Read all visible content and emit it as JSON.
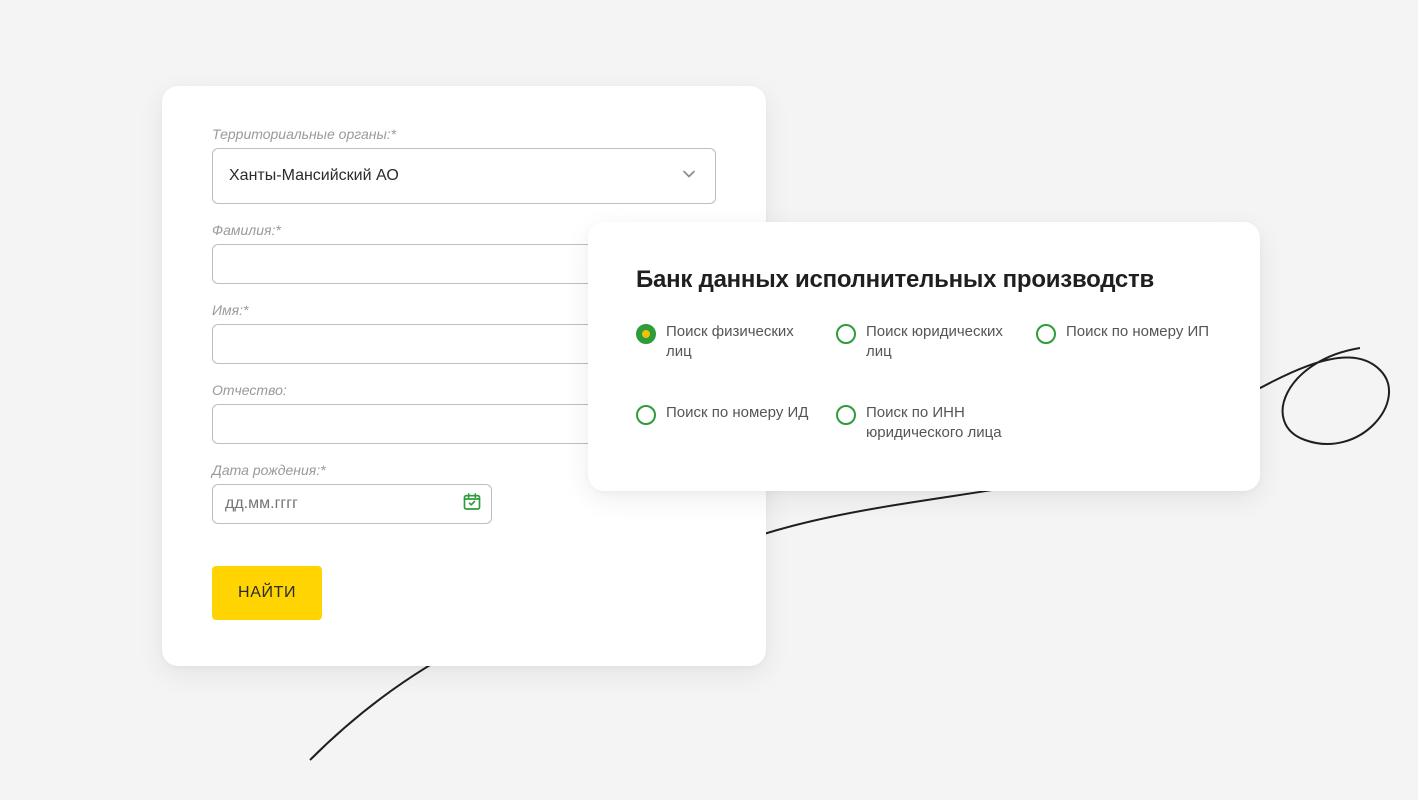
{
  "form": {
    "territory_label": "Территориальные органы:*",
    "territory_value": "Ханты-Мансийский АО",
    "lastname_label": "Фамилия:*",
    "lastname_value": "",
    "firstname_label": "Имя:*",
    "firstname_value": "",
    "patronymic_label": "Отчество:",
    "patronymic_value": "",
    "dob_label": "Дата рождения:*",
    "dob_placeholder": "дд.мм.гггг",
    "dob_value": "",
    "submit_label": "НАЙТИ"
  },
  "search_card": {
    "title": "Банк данных исполнительных производств",
    "options": [
      {
        "label": "Поиск физических лиц",
        "selected": true
      },
      {
        "label": "Поиск юридических лиц",
        "selected": false
      },
      {
        "label": "Поиск по номеру ИП",
        "selected": false
      },
      {
        "label": "Поиск по номеру ИД",
        "selected": false
      },
      {
        "label": "Поиск по ИНН юридического лица",
        "selected": false
      }
    ]
  },
  "colors": {
    "accent_green": "#2e9c3a",
    "accent_yellow": "#ffd400",
    "radio_inner_yellow": "#f2c100"
  }
}
